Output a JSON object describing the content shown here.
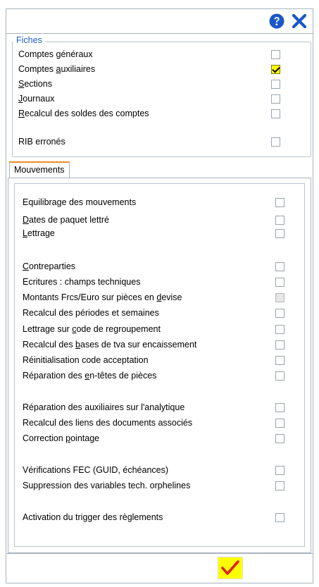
{
  "fiches": {
    "legend": "Fiches",
    "items": [
      {
        "pre": "Comptes généraux",
        "u": "",
        "post": "",
        "checked": false
      },
      {
        "pre": "Comptes ",
        "u": "a",
        "post": "uxiliaires",
        "checked": true
      },
      {
        "pre": "",
        "u": "S",
        "post": "ections",
        "checked": false
      },
      {
        "pre": "",
        "u": "J",
        "post": "ournaux",
        "checked": false
      },
      {
        "pre": "",
        "u": "R",
        "post": "ecalcul des soldes des comptes",
        "checked": false
      },
      {
        "pre": "RIB erronés",
        "u": "",
        "post": "",
        "checked": false
      }
    ]
  },
  "mouvements": {
    "tab_label": "Mouvements",
    "items": [
      {
        "pre": "Equilibrage des mouvements",
        "u": "",
        "post": "",
        "disabled": false
      },
      {
        "pre": "",
        "u": "D",
        "post": "ates de paquet lettré",
        "disabled": false
      },
      {
        "pre": "",
        "u": "L",
        "post": "ettrage",
        "disabled": false
      },
      {
        "pre": "",
        "u": "C",
        "post": "ontreparties",
        "disabled": false
      },
      {
        "pre": "Ecritures : champs techniques",
        "u": "",
        "post": "",
        "disabled": false
      },
      {
        "pre": "Montants Frcs/Euro sur pièces en ",
        "u": "d",
        "post": "evise",
        "disabled": true
      },
      {
        "pre": "Recalcul des périodes et semaines",
        "u": "",
        "post": "",
        "disabled": false
      },
      {
        "pre": "Lettrage sur ",
        "u": "c",
        "post": "ode de regroupement",
        "disabled": false
      },
      {
        "pre": "Recalcul des ",
        "u": "b",
        "post": "ases de tva sur encaissement",
        "disabled": false
      },
      {
        "pre": "Réinitialisation code acceptation",
        "u": "",
        "post": "",
        "disabled": false
      },
      {
        "pre": "Réparation des ",
        "u": "e",
        "post": "n-têtes de pièces",
        "disabled": false
      },
      {
        "pre": "Réparation des auxiliaires sur l'analytique",
        "u": "",
        "post": "",
        "disabled": false
      },
      {
        "pre": "Recalcul des liens des documents associés",
        "u": "",
        "post": "",
        "disabled": false
      },
      {
        "pre": "Correction ",
        "u": "p",
        "post": "ointage",
        "disabled": false
      },
      {
        "pre": "Vérifications FEC (GUID, échéances)",
        "u": "",
        "post": "",
        "disabled": false
      },
      {
        "pre": "Suppression des variables tech. orphelines",
        "u": "",
        "post": "",
        "disabled": false
      },
      {
        "pre": "Activation du trigger des règlements",
        "u": "",
        "post": "",
        "disabled": false
      }
    ]
  },
  "colors": {
    "accent_blue": "#1f5fc4",
    "check_yellow": "#ffff00",
    "check_red": "#e0201b",
    "tab_orange": "#f08a24"
  },
  "icons": {
    "help": "help-icon",
    "close": "close-icon",
    "validate": "validate-check-icon"
  }
}
